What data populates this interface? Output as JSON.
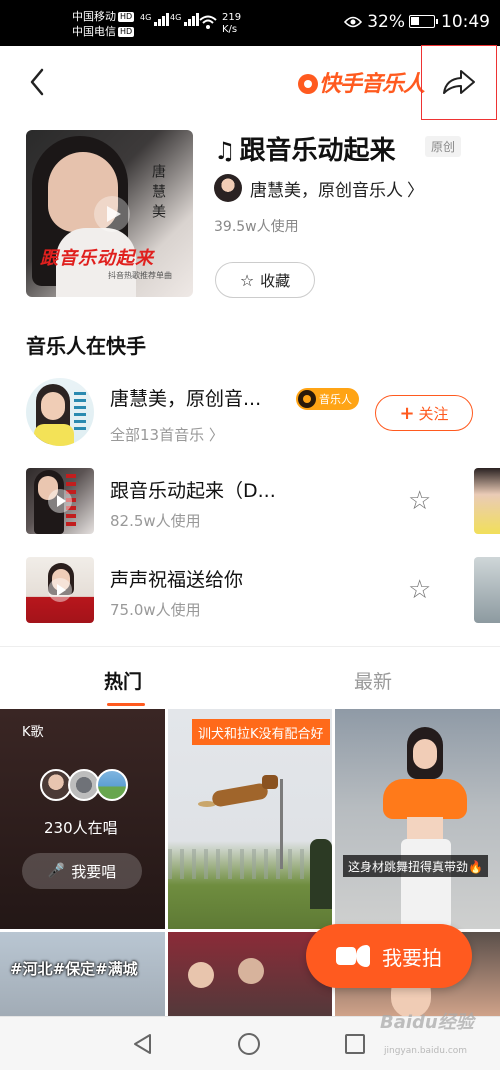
{
  "status_bar": {
    "carrier1": "中国移动",
    "carrier2": "中国电信",
    "hd": "HD",
    "net1": "4G",
    "net2": "4G",
    "speed_value": "219",
    "speed_unit": "K/s",
    "battery": "32%",
    "time": "10:49"
  },
  "header": {
    "logo_text": "快手音乐人",
    "back_icon": "back-arrow-icon",
    "share_icon": "share-icon"
  },
  "song": {
    "title": "跟音乐动起来",
    "badge": "原创",
    "artist": "唐慧美，原创音乐人",
    "usage": "39.5w人使用",
    "favorite_label": "收藏",
    "cover_vertical_text": "唐慧美",
    "cover_title": "跟音乐动起来",
    "cover_sub": "抖音热歌推荐单曲"
  },
  "musician_section": {
    "title": "音乐人在快手",
    "name": "唐慧美，原创音...",
    "badge": "音乐人",
    "all_songs": "全部13首音乐",
    "follow_label": "关注"
  },
  "tracks": [
    {
      "title": "跟音乐动起来（D...",
      "usage": "82.5w人使用"
    },
    {
      "title": "声声祝福送给你",
      "usage": "75.0w人使用"
    }
  ],
  "tabs": [
    {
      "label": "热门",
      "active": true
    },
    {
      "label": "最新",
      "active": false
    }
  ],
  "grid": {
    "kge": {
      "label": "K歌",
      "singing": "230人在唱",
      "button": "我要唱"
    },
    "video2_banner": "训犬和拉K没有配合好",
    "video3_caption": "这身材跳舞扭得真带劲🔥",
    "video4_caption": "#河北#保定#满城"
  },
  "shoot_button": "我要拍",
  "watermark": {
    "main": "Baidu经验",
    "sub": "jingyan.baidu.com"
  },
  "colors": {
    "accent": "#ff5a1f",
    "badge": "#ffa415"
  }
}
